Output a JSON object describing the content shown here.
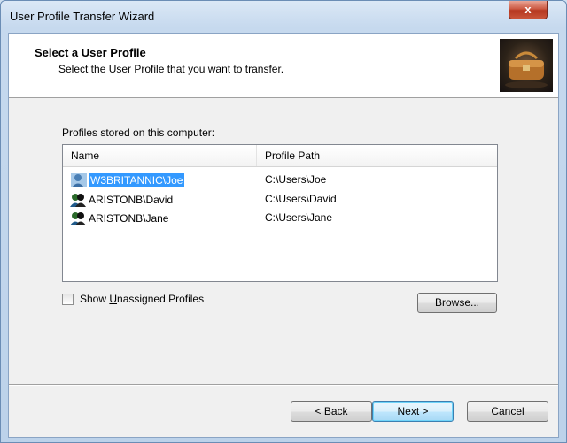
{
  "window": {
    "title": "User Profile Transfer Wizard",
    "close_label": "x"
  },
  "header": {
    "title": "Select a User Profile",
    "subtitle": "Select the User Profile that you want to transfer."
  },
  "profiles": {
    "label": "Profiles stored on this computer:",
    "columns": [
      "Name",
      "Profile Path"
    ],
    "rows": [
      {
        "name": "W3BRITANNIC\\Joe",
        "path": "C:\\Users\\Joe",
        "selected": true
      },
      {
        "name": "ARISTONB\\David",
        "path": "C:\\Users\\David",
        "selected": false
      },
      {
        "name": "ARISTONB\\Jane",
        "path": "C:\\Users\\Jane",
        "selected": false
      }
    ]
  },
  "options": {
    "show_unassigned": {
      "label_pre": "Show ",
      "label_mnemonic": "U",
      "label_post": "nassigned Profiles",
      "checked": false
    },
    "browse_label": "Browse..."
  },
  "footer": {
    "back_pre": "< ",
    "back_mnemonic": "B",
    "back_post": "ack",
    "next_label": "Next >",
    "cancel_label": "Cancel"
  },
  "icons": {
    "user_icon": "user-profile-icon",
    "header_image": "suitcase-icon"
  }
}
